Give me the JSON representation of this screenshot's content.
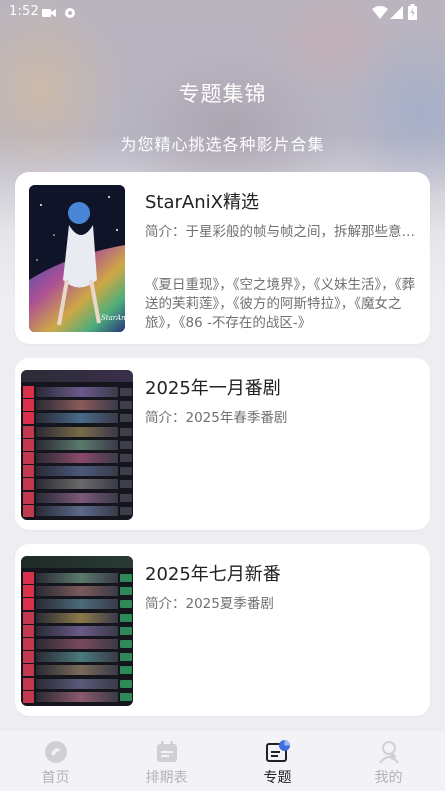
{
  "status_bar": {
    "time": "1:52"
  },
  "header": {
    "title": "专题集锦",
    "subtitle": "为您精心挑选各种影片合集"
  },
  "collections": [
    {
      "title": "StarAniX精选",
      "description": "简介：于星彩般的帧与帧之间，拆解那些意义非凡的时刻",
      "extra": "《夏日重现》，《空之境界》，《义妹生活》，《葬送的芙莉莲》，《彼方的阿斯特拉》，《魔女之旅》，《86 -不存在的战区-》",
      "thumb_signature": "StarAni"
    },
    {
      "title": "2025年一月番剧",
      "description": "简介：2025年春季番剧"
    },
    {
      "title": "2025年七月新番",
      "description": "简介：2025夏季番剧"
    }
  ],
  "tabbar": {
    "items": [
      {
        "label": "首页",
        "icon": "home-icon",
        "active": false
      },
      {
        "label": "排期表",
        "icon": "calendar-icon",
        "active": false
      },
      {
        "label": "专题",
        "icon": "topics-icon",
        "active": true
      },
      {
        "label": "我的",
        "icon": "profile-icon",
        "active": false
      }
    ]
  },
  "colors": {
    "active_tab": "#222222",
    "inactive_tab": "#b3b3b8",
    "card_bg": "#ffffff"
  }
}
